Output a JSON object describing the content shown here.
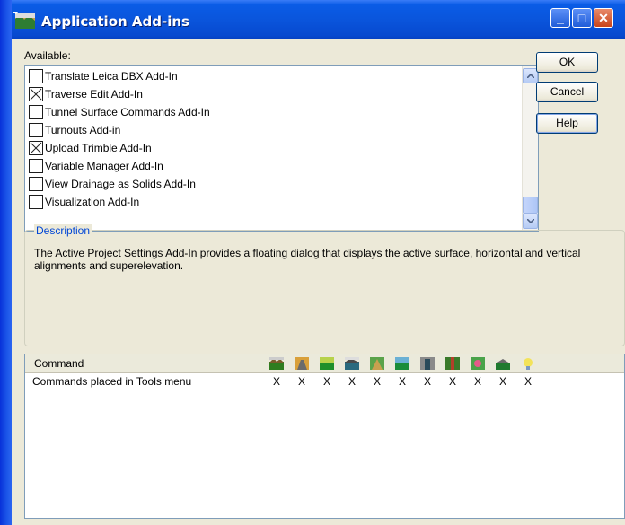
{
  "window": {
    "title": "Application Add-ins"
  },
  "available_label": "Available:",
  "addins": [
    {
      "label": "Translate Leica DBX Add-In",
      "checked": false
    },
    {
      "label": "Traverse Edit Add-In",
      "checked": true
    },
    {
      "label": "Tunnel Surface Commands Add-In",
      "checked": false
    },
    {
      "label": "Turnouts Add-in",
      "checked": false
    },
    {
      "label": "Upload Trimble Add-In",
      "checked": true
    },
    {
      "label": "Variable Manager Add-In",
      "checked": false
    },
    {
      "label": "View Drainage as Solids Add-In",
      "checked": false
    },
    {
      "label": "Visualization Add-In",
      "checked": false
    }
  ],
  "buttons": {
    "ok": "OK",
    "cancel": "Cancel",
    "help": "Help"
  },
  "description": {
    "legend": "Description",
    "text": "The Active Project Settings Add-In provides a floating dialog that displays the active surface, horizontal and vertical alignments and superelevation."
  },
  "command_table": {
    "header": "Command",
    "icons": [
      "terrain-icon",
      "road-icon",
      "surface-icon",
      "geometry-icon",
      "corridor-icon",
      "site-icon",
      "drainage-icon",
      "cross-section-icon",
      "survey-icon",
      "plan-icon",
      "lightbulb-icon"
    ],
    "rows": [
      {
        "label": "Commands placed in Tools menu",
        "marks": [
          "X",
          "X",
          "X",
          "X",
          "X",
          "X",
          "X",
          "X",
          "X",
          "X",
          "X"
        ]
      }
    ]
  }
}
